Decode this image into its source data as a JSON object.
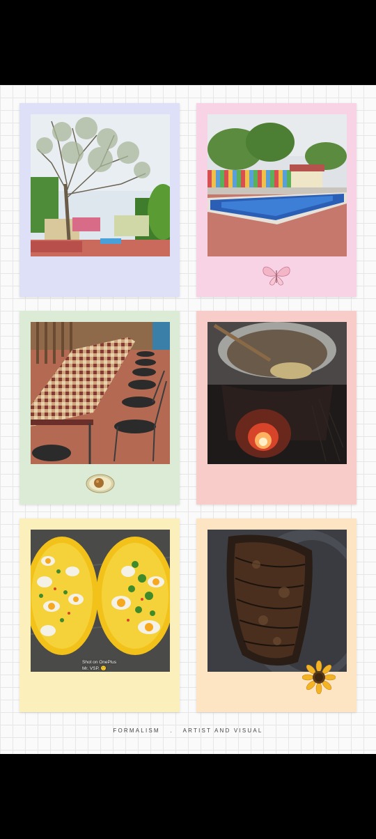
{
  "gallery": {
    "cards": [
      {
        "subject": "tree-garden-photo",
        "bg": "#dde0f7"
      },
      {
        "subject": "swimming-pool-photo",
        "bg": "#f8d3e6",
        "sticker": "butterfly-icon"
      },
      {
        "subject": "dining-table-photo",
        "bg": "#dcebd6",
        "sticker": "avocado-icon"
      },
      {
        "subject": "cooking-pot-fire-photo",
        "bg": "#f8cdc9"
      },
      {
        "subject": "egg-plates-photo",
        "bg": "#fbefbc"
      },
      {
        "subject": "grilled-fish-photo",
        "bg": "#fde4c3",
        "sticker": "sunflower-icon"
      }
    ],
    "watermark": {
      "line1": "Shot on OnePlus",
      "line2": "Mr. VSP. 🙂"
    }
  },
  "footer": {
    "left": "FORMALISM",
    "separator": ".",
    "right": "ARTIST AND VISUAL"
  }
}
